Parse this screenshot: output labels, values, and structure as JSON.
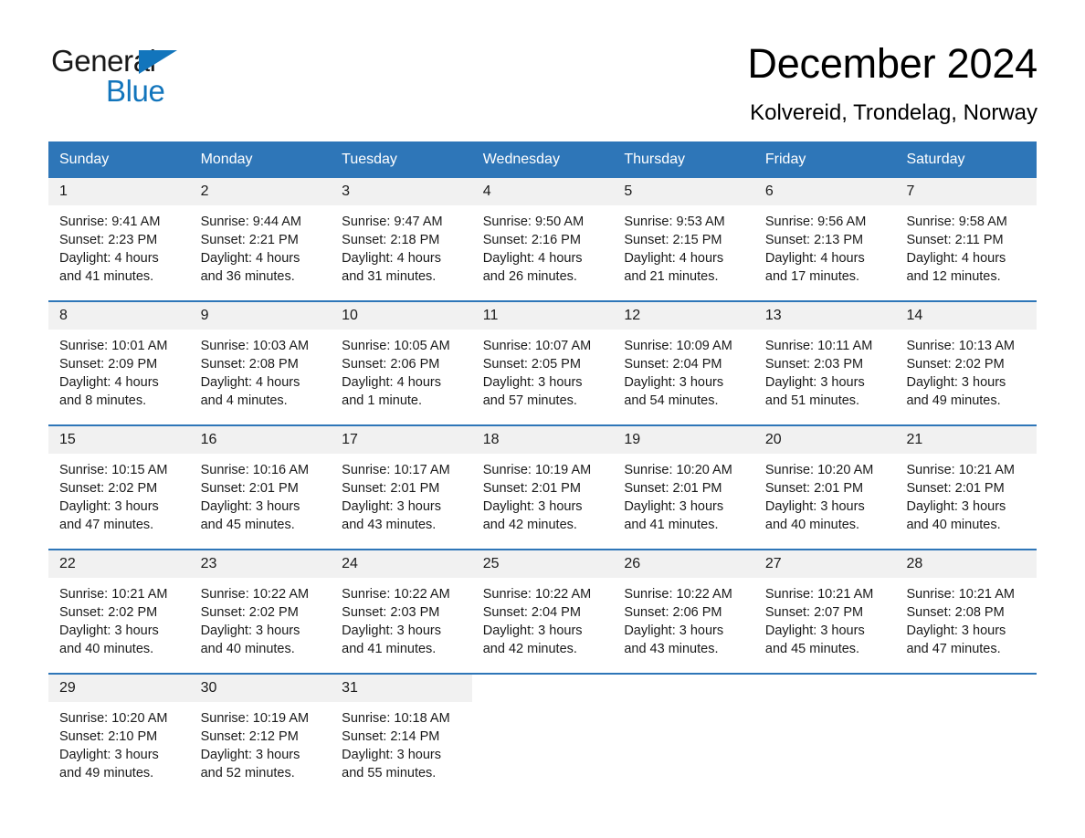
{
  "brand": {
    "name_part1": "General",
    "name_part2": "Blue",
    "logo_icon": "blue-triangle-icon",
    "accent_color": "#1275bc"
  },
  "header": {
    "title": "December 2024",
    "location": "Kolvereid, Trondelag, Norway"
  },
  "calendar": {
    "header_bg": "#2e76b8",
    "daynum_bg": "#f1f1f1",
    "weekdays": [
      "Sunday",
      "Monday",
      "Tuesday",
      "Wednesday",
      "Thursday",
      "Friday",
      "Saturday"
    ],
    "weeks": [
      [
        {
          "day": "1",
          "sunrise": "Sunrise: 9:41 AM",
          "sunset": "Sunset: 2:23 PM",
          "daylight_1": "Daylight: 4 hours",
          "daylight_2": "and 41 minutes."
        },
        {
          "day": "2",
          "sunrise": "Sunrise: 9:44 AM",
          "sunset": "Sunset: 2:21 PM",
          "daylight_1": "Daylight: 4 hours",
          "daylight_2": "and 36 minutes."
        },
        {
          "day": "3",
          "sunrise": "Sunrise: 9:47 AM",
          "sunset": "Sunset: 2:18 PM",
          "daylight_1": "Daylight: 4 hours",
          "daylight_2": "and 31 minutes."
        },
        {
          "day": "4",
          "sunrise": "Sunrise: 9:50 AM",
          "sunset": "Sunset: 2:16 PM",
          "daylight_1": "Daylight: 4 hours",
          "daylight_2": "and 26 minutes."
        },
        {
          "day": "5",
          "sunrise": "Sunrise: 9:53 AM",
          "sunset": "Sunset: 2:15 PM",
          "daylight_1": "Daylight: 4 hours",
          "daylight_2": "and 21 minutes."
        },
        {
          "day": "6",
          "sunrise": "Sunrise: 9:56 AM",
          "sunset": "Sunset: 2:13 PM",
          "daylight_1": "Daylight: 4 hours",
          "daylight_2": "and 17 minutes."
        },
        {
          "day": "7",
          "sunrise": "Sunrise: 9:58 AM",
          "sunset": "Sunset: 2:11 PM",
          "daylight_1": "Daylight: 4 hours",
          "daylight_2": "and 12 minutes."
        }
      ],
      [
        {
          "day": "8",
          "sunrise": "Sunrise: 10:01 AM",
          "sunset": "Sunset: 2:09 PM",
          "daylight_1": "Daylight: 4 hours",
          "daylight_2": "and 8 minutes."
        },
        {
          "day": "9",
          "sunrise": "Sunrise: 10:03 AM",
          "sunset": "Sunset: 2:08 PM",
          "daylight_1": "Daylight: 4 hours",
          "daylight_2": "and 4 minutes."
        },
        {
          "day": "10",
          "sunrise": "Sunrise: 10:05 AM",
          "sunset": "Sunset: 2:06 PM",
          "daylight_1": "Daylight: 4 hours",
          "daylight_2": "and 1 minute."
        },
        {
          "day": "11",
          "sunrise": "Sunrise: 10:07 AM",
          "sunset": "Sunset: 2:05 PM",
          "daylight_1": "Daylight: 3 hours",
          "daylight_2": "and 57 minutes."
        },
        {
          "day": "12",
          "sunrise": "Sunrise: 10:09 AM",
          "sunset": "Sunset: 2:04 PM",
          "daylight_1": "Daylight: 3 hours",
          "daylight_2": "and 54 minutes."
        },
        {
          "day": "13",
          "sunrise": "Sunrise: 10:11 AM",
          "sunset": "Sunset: 2:03 PM",
          "daylight_1": "Daylight: 3 hours",
          "daylight_2": "and 51 minutes."
        },
        {
          "day": "14",
          "sunrise": "Sunrise: 10:13 AM",
          "sunset": "Sunset: 2:02 PM",
          "daylight_1": "Daylight: 3 hours",
          "daylight_2": "and 49 minutes."
        }
      ],
      [
        {
          "day": "15",
          "sunrise": "Sunrise: 10:15 AM",
          "sunset": "Sunset: 2:02 PM",
          "daylight_1": "Daylight: 3 hours",
          "daylight_2": "and 47 minutes."
        },
        {
          "day": "16",
          "sunrise": "Sunrise: 10:16 AM",
          "sunset": "Sunset: 2:01 PM",
          "daylight_1": "Daylight: 3 hours",
          "daylight_2": "and 45 minutes."
        },
        {
          "day": "17",
          "sunrise": "Sunrise: 10:17 AM",
          "sunset": "Sunset: 2:01 PM",
          "daylight_1": "Daylight: 3 hours",
          "daylight_2": "and 43 minutes."
        },
        {
          "day": "18",
          "sunrise": "Sunrise: 10:19 AM",
          "sunset": "Sunset: 2:01 PM",
          "daylight_1": "Daylight: 3 hours",
          "daylight_2": "and 42 minutes."
        },
        {
          "day": "19",
          "sunrise": "Sunrise: 10:20 AM",
          "sunset": "Sunset: 2:01 PM",
          "daylight_1": "Daylight: 3 hours",
          "daylight_2": "and 41 minutes."
        },
        {
          "day": "20",
          "sunrise": "Sunrise: 10:20 AM",
          "sunset": "Sunset: 2:01 PM",
          "daylight_1": "Daylight: 3 hours",
          "daylight_2": "and 40 minutes."
        },
        {
          "day": "21",
          "sunrise": "Sunrise: 10:21 AM",
          "sunset": "Sunset: 2:01 PM",
          "daylight_1": "Daylight: 3 hours",
          "daylight_2": "and 40 minutes."
        }
      ],
      [
        {
          "day": "22",
          "sunrise": "Sunrise: 10:21 AM",
          "sunset": "Sunset: 2:02 PM",
          "daylight_1": "Daylight: 3 hours",
          "daylight_2": "and 40 minutes."
        },
        {
          "day": "23",
          "sunrise": "Sunrise: 10:22 AM",
          "sunset": "Sunset: 2:02 PM",
          "daylight_1": "Daylight: 3 hours",
          "daylight_2": "and 40 minutes."
        },
        {
          "day": "24",
          "sunrise": "Sunrise: 10:22 AM",
          "sunset": "Sunset: 2:03 PM",
          "daylight_1": "Daylight: 3 hours",
          "daylight_2": "and 41 minutes."
        },
        {
          "day": "25",
          "sunrise": "Sunrise: 10:22 AM",
          "sunset": "Sunset: 2:04 PM",
          "daylight_1": "Daylight: 3 hours",
          "daylight_2": "and 42 minutes."
        },
        {
          "day": "26",
          "sunrise": "Sunrise: 10:22 AM",
          "sunset": "Sunset: 2:06 PM",
          "daylight_1": "Daylight: 3 hours",
          "daylight_2": "and 43 minutes."
        },
        {
          "day": "27",
          "sunrise": "Sunrise: 10:21 AM",
          "sunset": "Sunset: 2:07 PM",
          "daylight_1": "Daylight: 3 hours",
          "daylight_2": "and 45 minutes."
        },
        {
          "day": "28",
          "sunrise": "Sunrise: 10:21 AM",
          "sunset": "Sunset: 2:08 PM",
          "daylight_1": "Daylight: 3 hours",
          "daylight_2": "and 47 minutes."
        }
      ],
      [
        {
          "day": "29",
          "sunrise": "Sunrise: 10:20 AM",
          "sunset": "Sunset: 2:10 PM",
          "daylight_1": "Daylight: 3 hours",
          "daylight_2": "and 49 minutes."
        },
        {
          "day": "30",
          "sunrise": "Sunrise: 10:19 AM",
          "sunset": "Sunset: 2:12 PM",
          "daylight_1": "Daylight: 3 hours",
          "daylight_2": "and 52 minutes."
        },
        {
          "day": "31",
          "sunrise": "Sunrise: 10:18 AM",
          "sunset": "Sunset: 2:14 PM",
          "daylight_1": "Daylight: 3 hours",
          "daylight_2": "and 55 minutes."
        },
        {
          "day": "",
          "sunrise": "",
          "sunset": "",
          "daylight_1": "",
          "daylight_2": ""
        },
        {
          "day": "",
          "sunrise": "",
          "sunset": "",
          "daylight_1": "",
          "daylight_2": ""
        },
        {
          "day": "",
          "sunrise": "",
          "sunset": "",
          "daylight_1": "",
          "daylight_2": ""
        },
        {
          "day": "",
          "sunrise": "",
          "sunset": "",
          "daylight_1": "",
          "daylight_2": ""
        }
      ]
    ]
  }
}
